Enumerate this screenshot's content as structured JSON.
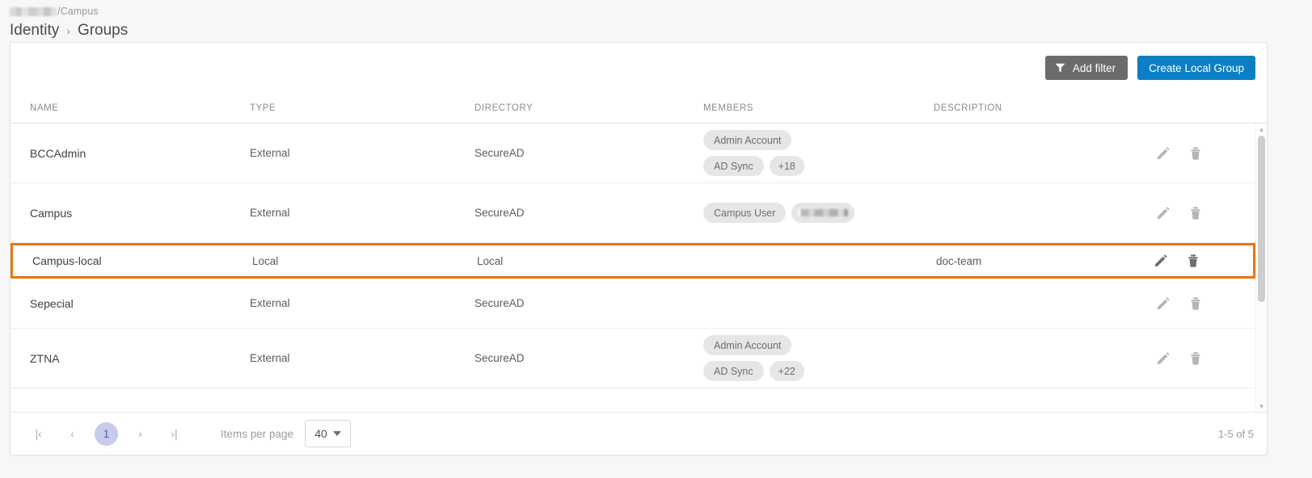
{
  "breadcrumb": {
    "tenant_path_suffix": "/Campus",
    "tenant_path_redacted": true,
    "section": "Identity",
    "separator": "›",
    "page": "Groups"
  },
  "toolbar": {
    "add_filter_label": "Add filter",
    "add_filter_icon": "funnel-icon",
    "create_label": "Create Local Group",
    "create_color": "#0b7fc4",
    "filter_color": "#6b6b6b"
  },
  "table": {
    "columns": [
      "NAME",
      "TYPE",
      "DIRECTORY",
      "MEMBERS",
      "DESCRIPTION"
    ],
    "highlight_color": "#e8760d",
    "rows": [
      {
        "name": "BCCAdmin",
        "type": "External",
        "directory": "SecureAD",
        "members": [
          "Admin Account",
          "AD Sync",
          "+18"
        ],
        "description": "",
        "highlighted": false
      },
      {
        "name": "Campus",
        "type": "External",
        "directory": "SecureAD",
        "members": [
          "Campus User"
        ],
        "members_redacted": 1,
        "description": "",
        "highlighted": false
      },
      {
        "name": "Campus-local",
        "type": "Local",
        "directory": "Local",
        "members": [],
        "description": "doc-team",
        "highlighted": true
      },
      {
        "name": "Sepecial",
        "type": "External",
        "directory": "SecureAD",
        "members": [],
        "description": "",
        "highlighted": false
      },
      {
        "name": "ZTNA",
        "type": "External",
        "directory": "SecureAD",
        "members": [
          "Admin Account",
          "AD Sync",
          "+22"
        ],
        "description": "",
        "highlighted": false
      }
    ],
    "row_actions": {
      "edit_icon": "pencil-icon",
      "delete_icon": "trash-icon"
    }
  },
  "footer": {
    "first_page_label": "|‹",
    "prev_page_label": "‹",
    "current_page": "1",
    "next_page_label": "›",
    "last_page_label": "›|",
    "items_per_page_label": "Items per page",
    "items_per_page_value": "40",
    "range_label": "1-5 of 5"
  }
}
